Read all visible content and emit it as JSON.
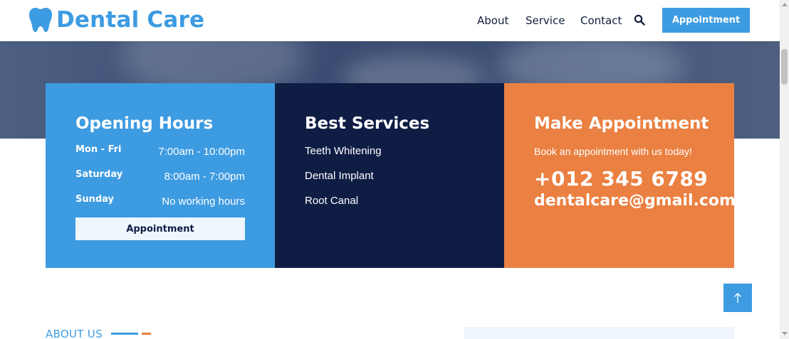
{
  "header": {
    "brand": "Dental Care",
    "nav": [
      {
        "label": "About"
      },
      {
        "label": "Service"
      },
      {
        "label": "Contact"
      }
    ],
    "search_icon": "search-icon",
    "appointment_label": "Appointment"
  },
  "cards": {
    "hours": {
      "title": "Opening Hours",
      "rows": [
        {
          "day": "Mon - Fri",
          "time": "7:00am - 10:00pm"
        },
        {
          "day": "Saturday",
          "time": "8:00am - 7:00pm"
        },
        {
          "day": "Sunday",
          "time": "No working hours"
        }
      ],
      "button_label": "Appointment"
    },
    "services": {
      "title": "Best Services",
      "items": [
        "Teeth Whitening",
        "Dental Implant",
        "Root Canal"
      ]
    },
    "appointment": {
      "title": "Make Appointment",
      "text": "Book an appointment with us today!",
      "phone": "+012 345 6789",
      "email": "dentalcare@gmail.com"
    }
  },
  "about": {
    "label": "ABOUT US"
  },
  "colors": {
    "primary": "#3d9be1",
    "dark": "#0f1d45",
    "accent": "#ea8041"
  }
}
